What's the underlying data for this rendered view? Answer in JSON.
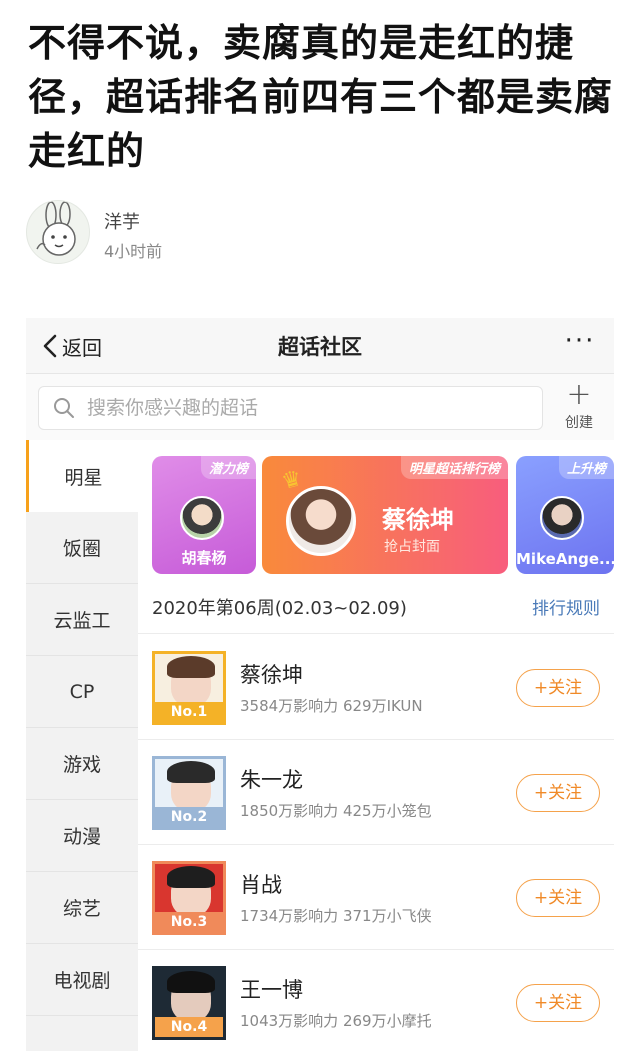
{
  "headline": "不得不说，卖腐真的是走红的捷径，超话排名前四有三个都是卖腐走红的",
  "author": {
    "name": "洋芋",
    "time": "4小时前"
  },
  "nav": {
    "back_label": "返回",
    "title": "超话社区",
    "more_label": "···"
  },
  "search": {
    "placeholder": "搜索你感兴趣的超话",
    "create_label": "创建"
  },
  "sidebar": {
    "items": [
      {
        "label": "明星",
        "active": true
      },
      {
        "label": "饭圈"
      },
      {
        "label": "云监工"
      },
      {
        "label": "CP"
      },
      {
        "label": "游戏"
      },
      {
        "label": "动漫"
      },
      {
        "label": "综艺"
      },
      {
        "label": "电视剧"
      }
    ]
  },
  "banners": {
    "left": {
      "tag": "潜力榜",
      "name": "胡春杨"
    },
    "middle": {
      "tag": "明星超话排行榜",
      "name": "蔡徐坤",
      "sub": "抢占封面"
    },
    "right": {
      "tag": "上升榜",
      "name": "MikeAnge..."
    }
  },
  "week": {
    "label": "2020年第06周(02.03~02.09)",
    "rules_label": "排行规则"
  },
  "follow_label": "+关注",
  "rankings": [
    {
      "rank": "No.1",
      "name": "蔡徐坤",
      "stats": "3584万影响力 629万IKUN",
      "badge_color": "#f4b227",
      "bg": "#f7efe0",
      "body": "#eaeaea"
    },
    {
      "rank": "No.2",
      "name": "朱一龙",
      "stats": "1850万影响力 425万小笼包",
      "badge_color": "#9ab6d6",
      "bg": "#e9f1f8",
      "body": "#c9302c"
    },
    {
      "rank": "No.3",
      "name": "肖战",
      "stats": "1734万影响力 371万小飞侠",
      "badge_color": "#f08a5a",
      "bg": "#d9362f",
      "body": "#2a2a2a"
    },
    {
      "rank": "No.4",
      "name": "王一博",
      "stats": "1043万影响力 269万小摩托",
      "badge_color": "#f5a24b",
      "bg": "#1e2a35",
      "body": "#1a1a1a"
    }
  ]
}
